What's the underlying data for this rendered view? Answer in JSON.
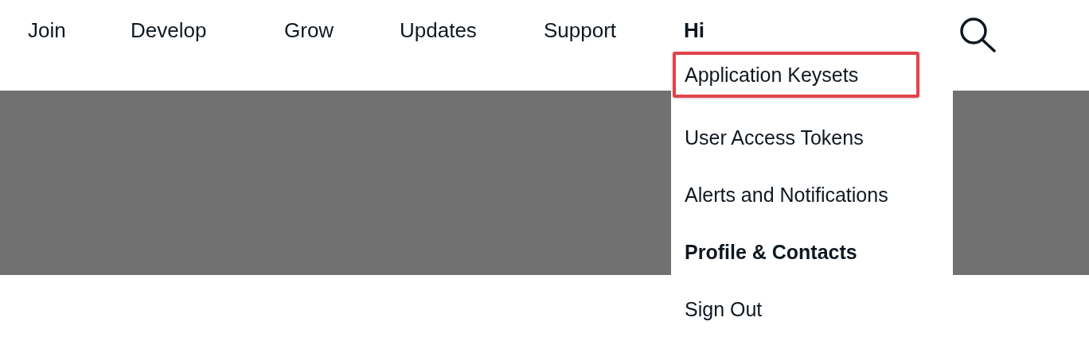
{
  "nav": {
    "items": [
      {
        "label": "Join"
      },
      {
        "label": "Develop"
      },
      {
        "label": "Grow"
      },
      {
        "label": "Updates"
      },
      {
        "label": "Support"
      },
      {
        "label": "Hi",
        "expanded": true
      }
    ]
  },
  "dropdown": {
    "items": [
      {
        "label": "Application Keysets",
        "highlighted": true,
        "selected": false
      },
      {
        "label": "User Access Tokens",
        "highlighted": false,
        "selected": false
      },
      {
        "label": "Alerts and Notifications",
        "highlighted": false,
        "selected": false
      },
      {
        "label": "Profile & Contacts",
        "highlighted": false,
        "selected": true
      },
      {
        "label": "Sign Out",
        "highlighted": false,
        "selected": false
      }
    ]
  }
}
